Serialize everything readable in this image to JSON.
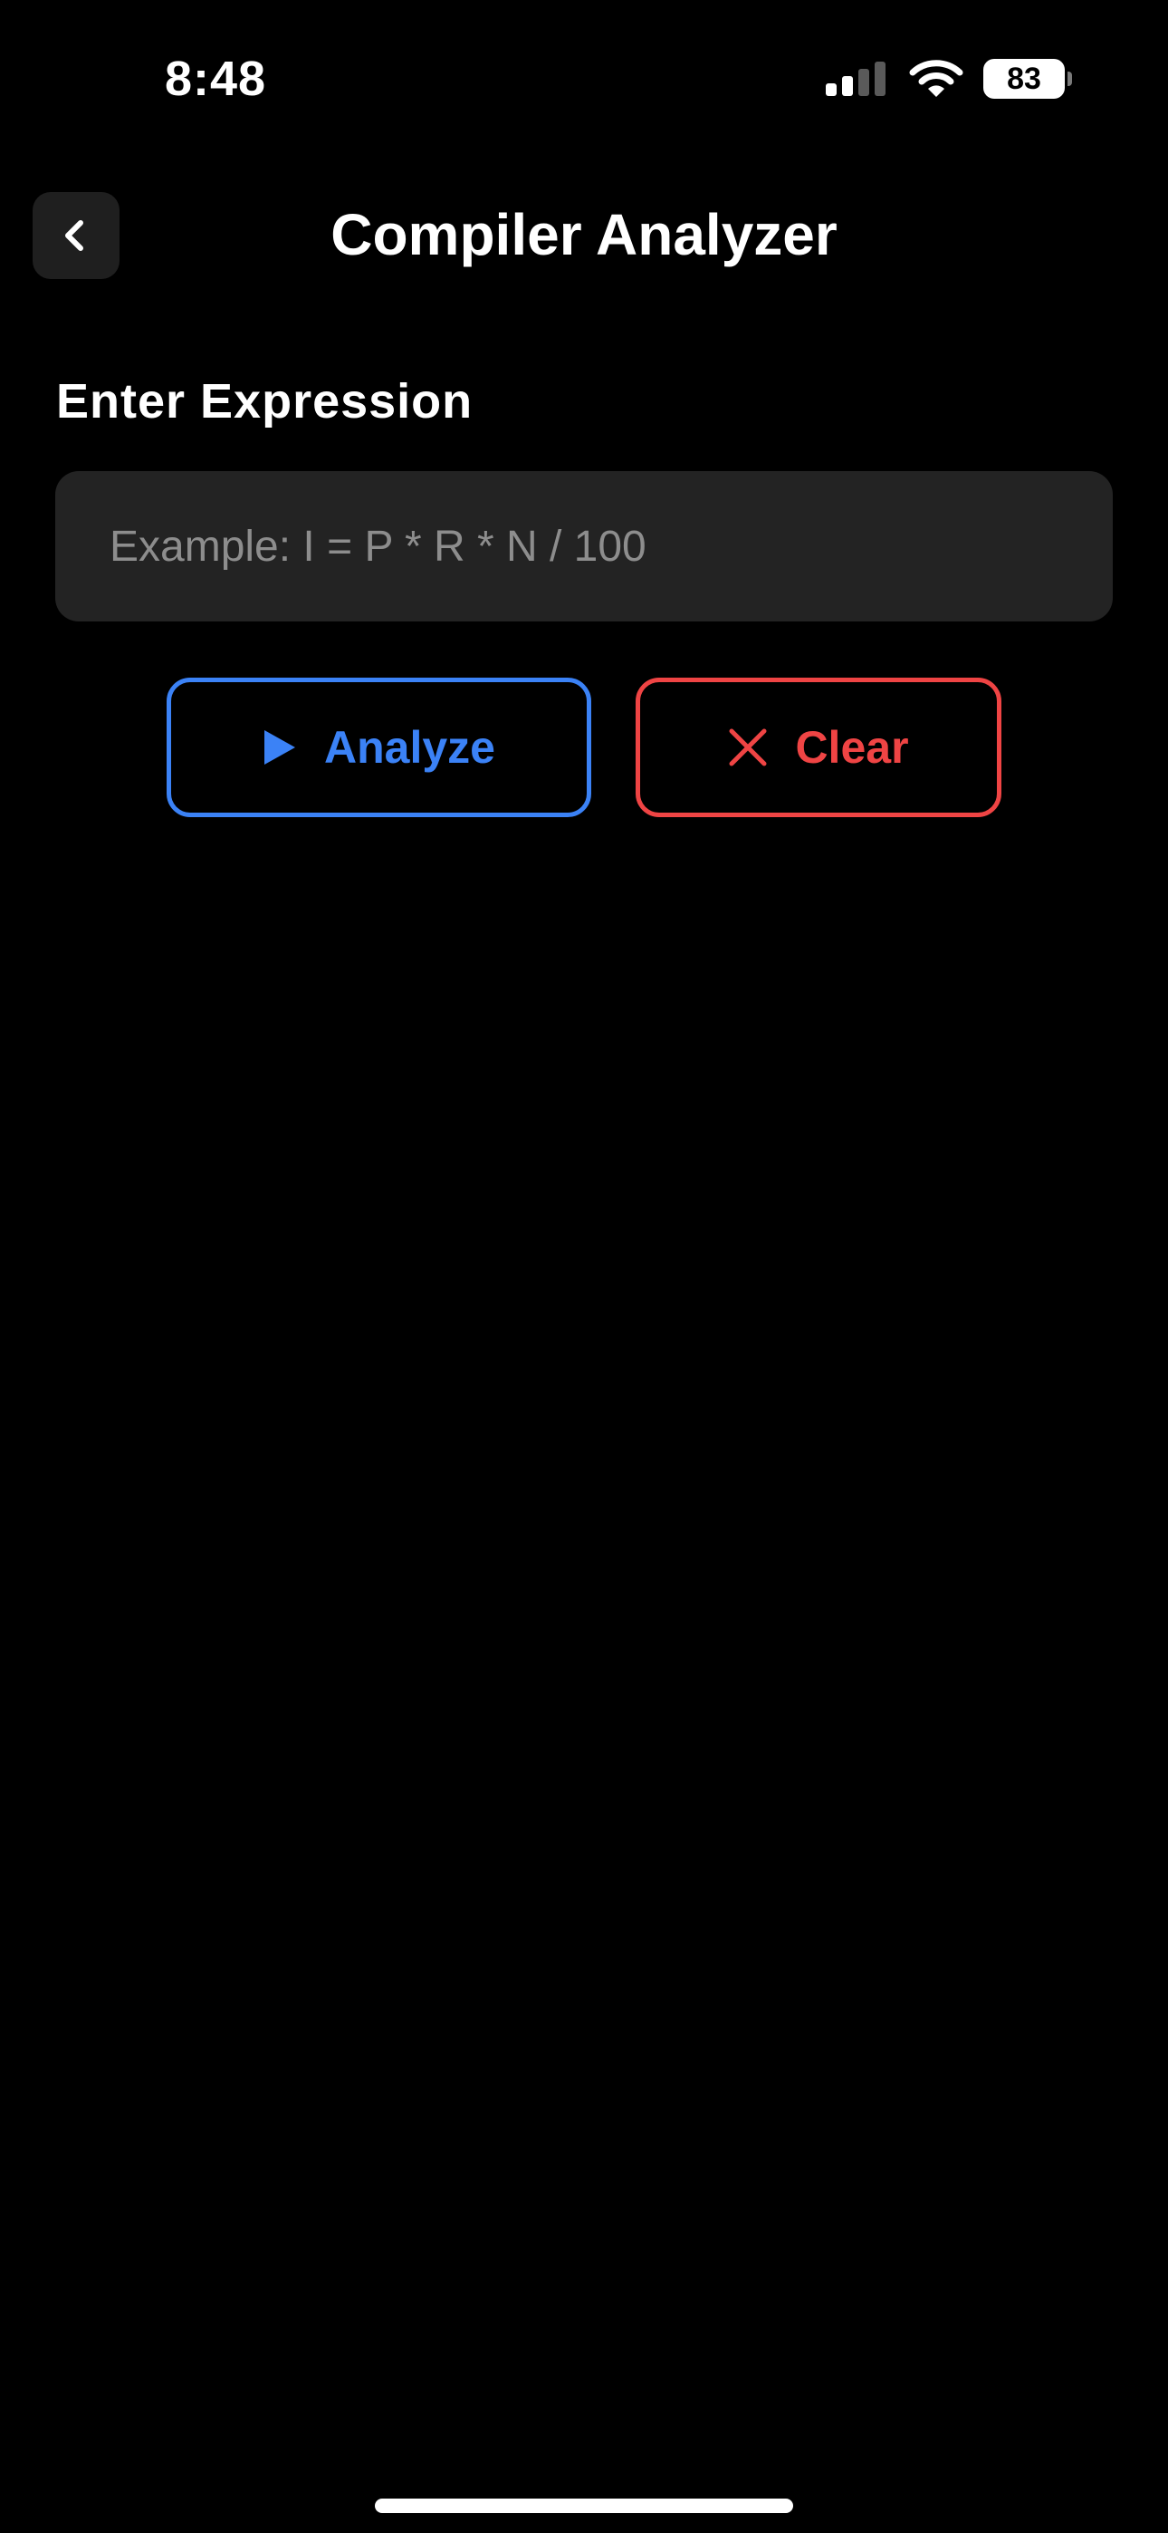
{
  "status_bar": {
    "time": "8:48",
    "battery_level": "83",
    "signal_bars_active": 2,
    "signal_bars_total": 4,
    "icons": [
      "signal-icon",
      "wifi-icon",
      "battery-icon"
    ]
  },
  "header": {
    "title": "Compiler Analyzer",
    "back_icon": "chevron-left-icon"
  },
  "expression": {
    "label": "Enter Expression",
    "value": "",
    "placeholder": "Example: I = P * R * N / 100"
  },
  "actions": {
    "analyze_label": "Analyze",
    "analyze_icon": "play-icon",
    "clear_label": "Clear",
    "clear_icon": "close-icon"
  },
  "colors": {
    "background": "#000000",
    "surface": "#232323",
    "analyze_accent": "#3b82f6",
    "clear_accent": "#ef4444",
    "placeholder": "#8d8d8d"
  }
}
